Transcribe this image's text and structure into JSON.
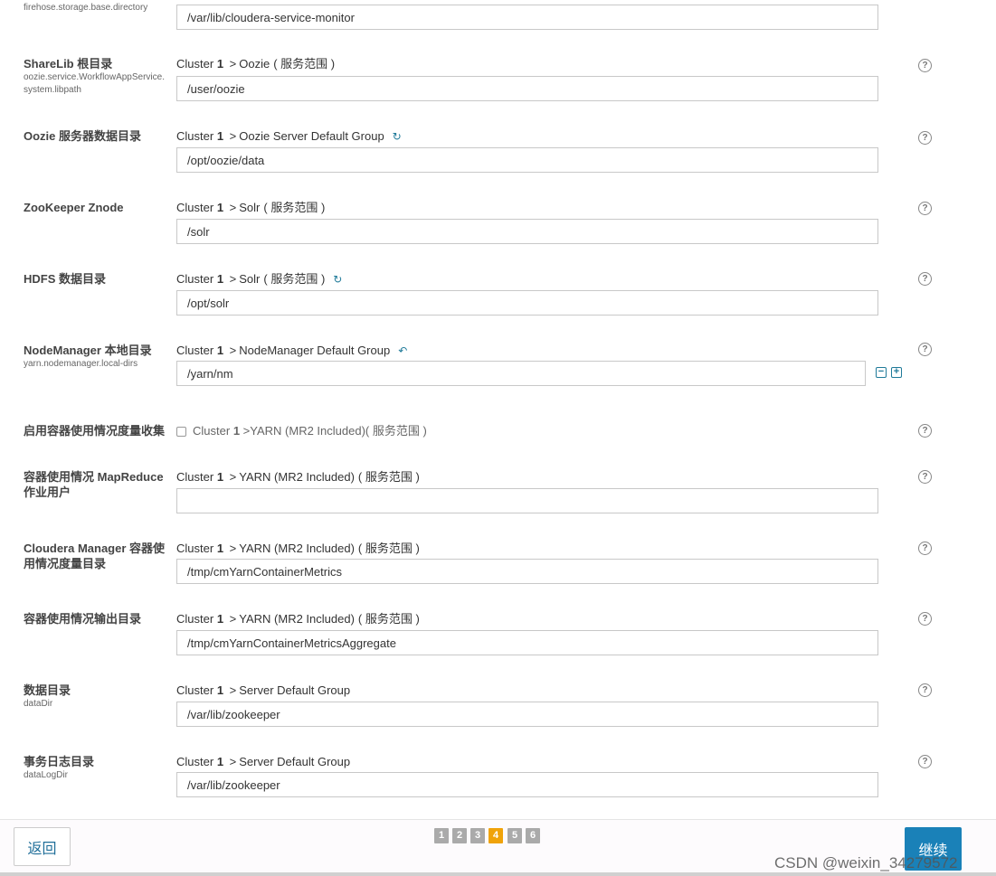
{
  "top_row": {
    "key": "firehose.storage.base.directory",
    "value": "/var/lib/cloudera-service-monitor"
  },
  "rows": [
    {
      "title": "ShareLib 根目录",
      "key": "oozie.service.WorkflowAppService.system.libpath",
      "scope_cluster": "Cluster",
      "scope_num": "1",
      "scope_sep": ">",
      "scope_target": "Oozie",
      "scope_paren": "( 服务范围 )",
      "value": "/user/oozie"
    },
    {
      "title": "Oozie 服务器数据目录",
      "key": "",
      "scope_cluster": "Cluster",
      "scope_num": "1",
      "scope_sep": ">",
      "scope_target": "Oozie Server Default Group",
      "scope_paren": "",
      "value": "/opt/oozie/data"
    },
    {
      "title": "ZooKeeper Znode",
      "key": "",
      "scope_cluster": "Cluster",
      "scope_num": "1",
      "scope_sep": ">",
      "scope_target": "Solr",
      "scope_paren": "( 服务范围 )",
      "value": "/solr"
    },
    {
      "title": "HDFS 数据目录",
      "key": "",
      "scope_cluster": "Cluster",
      "scope_num": "1",
      "scope_sep": ">",
      "scope_target": "Solr",
      "scope_paren": "( 服务范围 )",
      "value": "/opt/solr"
    },
    {
      "title": "NodeManager 本地目录",
      "key": "yarn.nodemanager.local-dirs",
      "scope_cluster": "Cluster",
      "scope_num": "1",
      "scope_sep": ">",
      "scope_target": "NodeManager Default Group",
      "scope_paren": "",
      "value": "/yarn/nm"
    },
    {
      "title": "启用容器使用情况度量收集",
      "key": "",
      "scope_cluster": "Cluster",
      "scope_num": "1",
      "scope_sep": ">",
      "scope_target": "YARN (MR2 Included)",
      "scope_paren": "( 服务范围 )",
      "value": ""
    },
    {
      "title": "容器使用情况 MapReduce 作业用户",
      "key": "",
      "scope_cluster": "Cluster",
      "scope_num": "1",
      "scope_sep": ">",
      "scope_target": "YARN (MR2 Included)",
      "scope_paren": "( 服务范围 )",
      "value": ""
    },
    {
      "title": "Cloudera Manager 容器使用情况度量目录",
      "key": "",
      "scope_cluster": "Cluster",
      "scope_num": "1",
      "scope_sep": ">",
      "scope_target": "YARN (MR2 Included)",
      "scope_paren": "( 服务范围 )",
      "value": "/tmp/cmYarnContainerMetrics"
    },
    {
      "title": "容器使用情况输出目录",
      "key": "",
      "scope_cluster": "Cluster",
      "scope_num": "1",
      "scope_sep": ">",
      "scope_target": "YARN (MR2 Included)",
      "scope_paren": "( 服务范围 )",
      "value": "/tmp/cmYarnContainerMetricsAggregate"
    },
    {
      "title": "数据目录",
      "key": "dataDir",
      "scope_cluster": "Cluster",
      "scope_num": "1",
      "scope_sep": ">",
      "scope_target": "Server Default Group",
      "scope_paren": "",
      "value": "/var/lib/zookeeper"
    },
    {
      "title": "事务日志目录",
      "key": "dataLogDir",
      "scope_cluster": "Cluster",
      "scope_num": "1",
      "scope_sep": ">",
      "scope_target": "Server Default Group",
      "scope_paren": "",
      "value": "/var/lib/zookeeper"
    }
  ],
  "icons": {
    "help": "?",
    "refresh": "↻",
    "undo": "↶",
    "remove": "−",
    "add": "+"
  },
  "footer": {
    "back_label": "返回",
    "next_label": "继续",
    "pages": [
      "1",
      "2",
      "3",
      "4",
      "5",
      "6"
    ],
    "active_page": "4",
    "watermark": "CSDN @weixin_34279572"
  },
  "colors": {
    "accent": "#1a81b8",
    "active_page": "#f0a30a",
    "inactive_page": "#aaaaaa",
    "icon_teal": "#1f7a99"
  }
}
